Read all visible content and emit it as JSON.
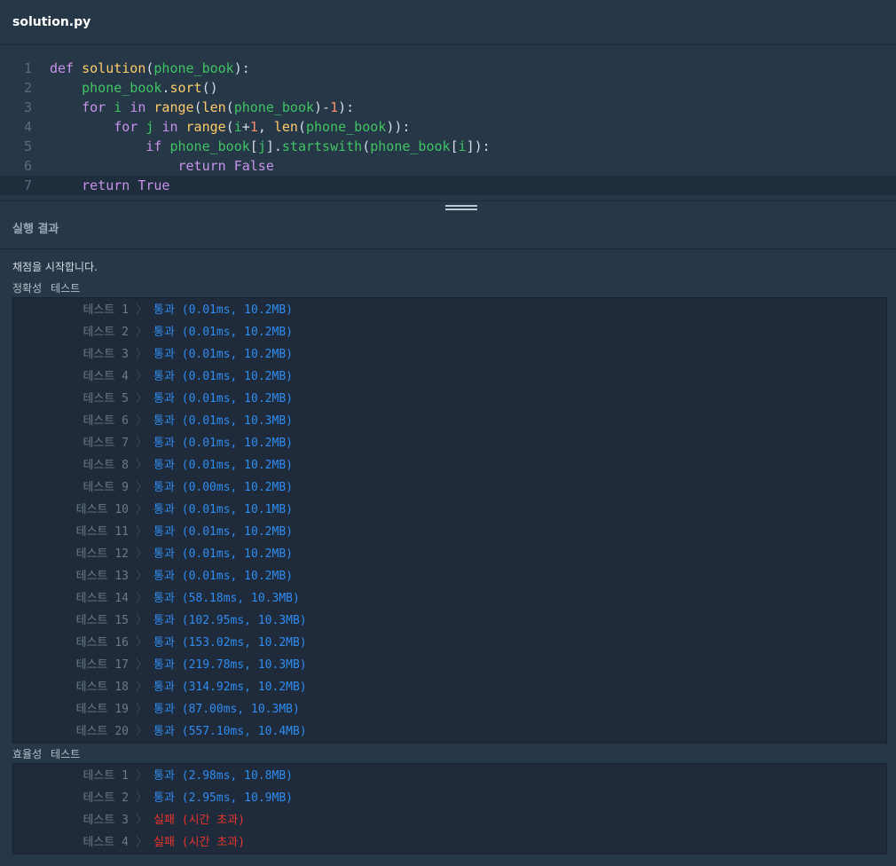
{
  "tab": {
    "filename": "solution.py"
  },
  "editor": {
    "lines": [
      {
        "num": "1",
        "tokens": [
          {
            "t": "def",
            "c": "kw"
          },
          {
            "t": " ",
            "c": "pl"
          },
          {
            "t": "solution",
            "c": "fn"
          },
          {
            "t": "(",
            "c": "pl"
          },
          {
            "t": "phone_book",
            "c": "var"
          },
          {
            "t": "):",
            "c": "pl"
          }
        ]
      },
      {
        "num": "2",
        "tokens": [
          {
            "t": "    ",
            "c": "pl"
          },
          {
            "t": "phone_book",
            "c": "var"
          },
          {
            "t": ".",
            "c": "pl"
          },
          {
            "t": "sort",
            "c": "fn"
          },
          {
            "t": "()",
            "c": "pl"
          }
        ]
      },
      {
        "num": "3",
        "tokens": [
          {
            "t": "    ",
            "c": "pl"
          },
          {
            "t": "for",
            "c": "kw"
          },
          {
            "t": " ",
            "c": "pl"
          },
          {
            "t": "i",
            "c": "var"
          },
          {
            "t": " ",
            "c": "pl"
          },
          {
            "t": "in",
            "c": "kw"
          },
          {
            "t": " ",
            "c": "pl"
          },
          {
            "t": "range",
            "c": "fn"
          },
          {
            "t": "(",
            "c": "pl"
          },
          {
            "t": "len",
            "c": "fn"
          },
          {
            "t": "(",
            "c": "pl"
          },
          {
            "t": "phone_book",
            "c": "var"
          },
          {
            "t": ")-",
            "c": "pl"
          },
          {
            "t": "1",
            "c": "num"
          },
          {
            "t": "):",
            "c": "pl"
          }
        ]
      },
      {
        "num": "4",
        "tokens": [
          {
            "t": "        ",
            "c": "pl"
          },
          {
            "t": "for",
            "c": "kw"
          },
          {
            "t": " ",
            "c": "pl"
          },
          {
            "t": "j",
            "c": "var"
          },
          {
            "t": " ",
            "c": "pl"
          },
          {
            "t": "in",
            "c": "kw"
          },
          {
            "t": " ",
            "c": "pl"
          },
          {
            "t": "range",
            "c": "fn"
          },
          {
            "t": "(",
            "c": "pl"
          },
          {
            "t": "i",
            "c": "var"
          },
          {
            "t": "+",
            "c": "pl"
          },
          {
            "t": "1",
            "c": "num"
          },
          {
            "t": ", ",
            "c": "pl"
          },
          {
            "t": "len",
            "c": "fn"
          },
          {
            "t": "(",
            "c": "pl"
          },
          {
            "t": "phone_book",
            "c": "var"
          },
          {
            "t": ")):",
            "c": "pl"
          }
        ]
      },
      {
        "num": "5",
        "tokens": [
          {
            "t": "            ",
            "c": "pl"
          },
          {
            "t": "if",
            "c": "kw"
          },
          {
            "t": " ",
            "c": "pl"
          },
          {
            "t": "phone_book",
            "c": "var"
          },
          {
            "t": "[",
            "c": "pl"
          },
          {
            "t": "j",
            "c": "var"
          },
          {
            "t": "].",
            "c": "pl"
          },
          {
            "t": "startswith",
            "c": "var"
          },
          {
            "t": "(",
            "c": "pl"
          },
          {
            "t": "phone_book",
            "c": "var"
          },
          {
            "t": "[",
            "c": "pl"
          },
          {
            "t": "i",
            "c": "var"
          },
          {
            "t": "]):",
            "c": "pl"
          }
        ]
      },
      {
        "num": "6",
        "tokens": [
          {
            "t": "                ",
            "c": "pl"
          },
          {
            "t": "return",
            "c": "kw"
          },
          {
            "t": " ",
            "c": "pl"
          },
          {
            "t": "False",
            "c": "kw"
          }
        ]
      },
      {
        "num": "7",
        "active": true,
        "tokens": [
          {
            "t": "    ",
            "c": "pl"
          },
          {
            "t": "return",
            "c": "kw"
          },
          {
            "t": " ",
            "c": "pl"
          },
          {
            "t": "True",
            "c": "kw"
          }
        ]
      }
    ]
  },
  "result": {
    "header": "실행 결과",
    "status": "채점을 시작합니다.",
    "sections": [
      {
        "label_a": "정확성",
        "label_b": "테스트",
        "tests": [
          {
            "name": "테스트 1",
            "result": "통과 (0.01ms, 10.2MB)",
            "pass": true
          },
          {
            "name": "테스트 2",
            "result": "통과 (0.01ms, 10.2MB)",
            "pass": true
          },
          {
            "name": "테스트 3",
            "result": "통과 (0.01ms, 10.2MB)",
            "pass": true
          },
          {
            "name": "테스트 4",
            "result": "통과 (0.01ms, 10.2MB)",
            "pass": true
          },
          {
            "name": "테스트 5",
            "result": "통과 (0.01ms, 10.2MB)",
            "pass": true
          },
          {
            "name": "테스트 6",
            "result": "통과 (0.01ms, 10.3MB)",
            "pass": true
          },
          {
            "name": "테스트 7",
            "result": "통과 (0.01ms, 10.2MB)",
            "pass": true
          },
          {
            "name": "테스트 8",
            "result": "통과 (0.01ms, 10.2MB)",
            "pass": true
          },
          {
            "name": "테스트 9",
            "result": "통과 (0.00ms, 10.2MB)",
            "pass": true
          },
          {
            "name": "테스트 10",
            "result": "통과 (0.01ms, 10.1MB)",
            "pass": true
          },
          {
            "name": "테스트 11",
            "result": "통과 (0.01ms, 10.2MB)",
            "pass": true
          },
          {
            "name": "테스트 12",
            "result": "통과 (0.01ms, 10.2MB)",
            "pass": true
          },
          {
            "name": "테스트 13",
            "result": "통과 (0.01ms, 10.2MB)",
            "pass": true
          },
          {
            "name": "테스트 14",
            "result": "통과 (58.18ms, 10.3MB)",
            "pass": true
          },
          {
            "name": "테스트 15",
            "result": "통과 (102.95ms, 10.3MB)",
            "pass": true
          },
          {
            "name": "테스트 16",
            "result": "통과 (153.02ms, 10.2MB)",
            "pass": true
          },
          {
            "name": "테스트 17",
            "result": "통과 (219.78ms, 10.3MB)",
            "pass": true
          },
          {
            "name": "테스트 18",
            "result": "통과 (314.92ms, 10.2MB)",
            "pass": true
          },
          {
            "name": "테스트 19",
            "result": "통과 (87.00ms, 10.3MB)",
            "pass": true
          },
          {
            "name": "테스트 20",
            "result": "통과 (557.10ms, 10.4MB)",
            "pass": true
          }
        ]
      },
      {
        "label_a": "효율성",
        "label_b": "테스트",
        "tests": [
          {
            "name": "테스트 1",
            "result": "통과 (2.98ms, 10.8MB)",
            "pass": true
          },
          {
            "name": "테스트 2",
            "result": "통과 (2.95ms, 10.9MB)",
            "pass": true
          },
          {
            "name": "테스트 3",
            "result": "실패 (시간 초과)",
            "pass": false
          },
          {
            "name": "테스트 4",
            "result": "실패 (시간 초과)",
            "pass": false
          }
        ]
      }
    ],
    "separator_glyph": "〉"
  }
}
